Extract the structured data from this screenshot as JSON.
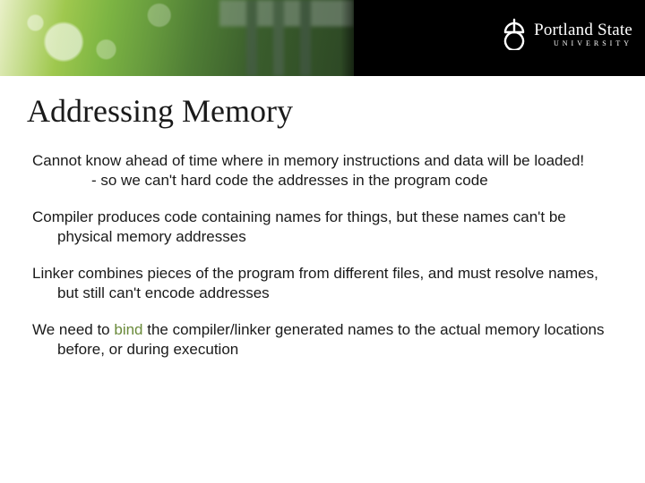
{
  "logo": {
    "main": "Portland State",
    "sub": "UNIVERSITY"
  },
  "title": "Addressing Memory",
  "paragraphs": {
    "p1_line1": "Cannot know ahead of time where in memory instructions and data will be loaded!",
    "p1_sub": "- so we can't hard code the addresses in the program code",
    "p2": "Compiler produces code containing names for things, but these names can't be physical memory addresses",
    "p3": "Linker combines pieces of the program from different files, and must resolve names, but still can't encode addresses",
    "p4_a": "We need to ",
    "p4_bind": "bind",
    "p4_b": " the compiler/linker generated names to the actual memory locations before, or during execution"
  }
}
